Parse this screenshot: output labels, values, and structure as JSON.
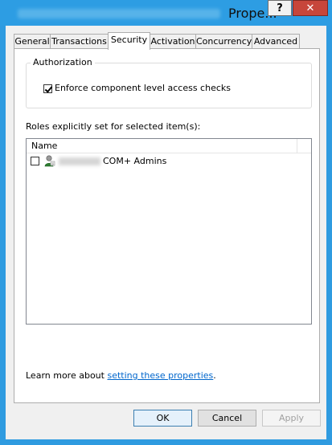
{
  "window": {
    "title": "Prope...",
    "help_glyph": "?",
    "close_glyph": "✕"
  },
  "tabs": [
    {
      "label": "General"
    },
    {
      "label": "Transactions"
    },
    {
      "label": "Security"
    },
    {
      "label": "Activation"
    },
    {
      "label": "Concurrency"
    },
    {
      "label": "Advanced"
    }
  ],
  "active_tab": "Security",
  "authorization": {
    "group_label": "Authorization",
    "enforce_label": "Enforce component level access checks",
    "enforce_checked": true
  },
  "roles": {
    "label": "Roles explicitly set for selected item(s):",
    "column_header": "Name",
    "items": [
      {
        "label": "COM+ Admins",
        "checked": false,
        "icon": "user-icon"
      }
    ]
  },
  "learn_more": {
    "prefix": "Learn more about ",
    "link_text": "setting these properties",
    "suffix": "."
  },
  "buttons": {
    "ok": "OK",
    "cancel": "Cancel",
    "apply": "Apply"
  }
}
